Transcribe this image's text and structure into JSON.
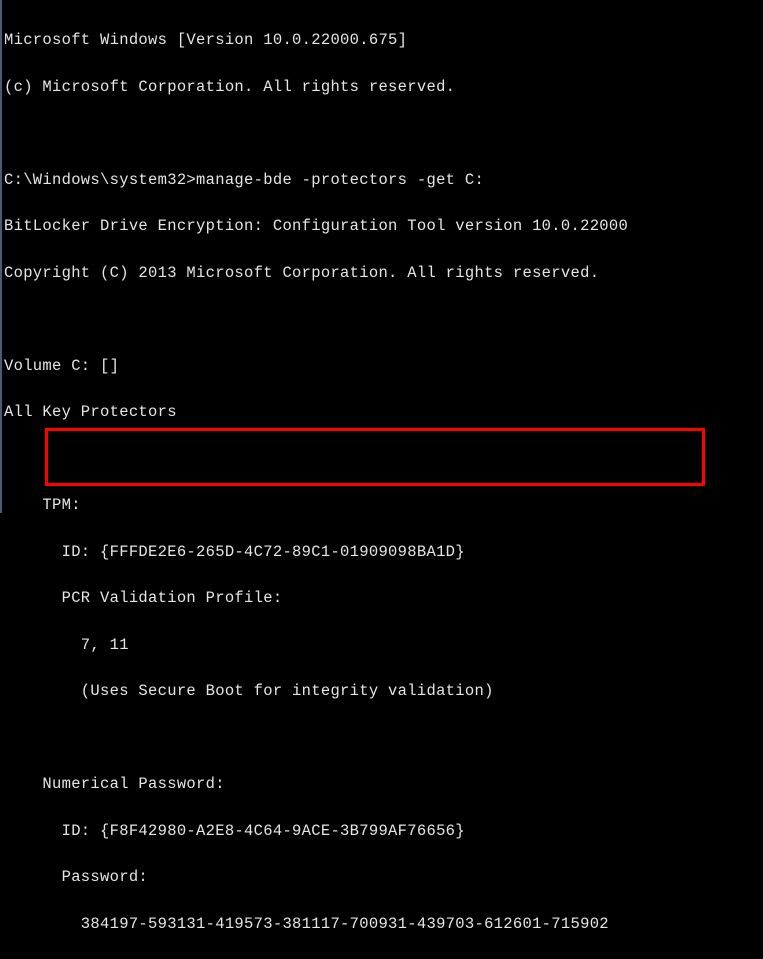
{
  "header": {
    "line1": "Microsoft Windows [Version 10.0.22000.675]",
    "line2": "(c) Microsoft Corporation. All rights reserved."
  },
  "command": {
    "prompt": "C:\\Windows\\system32>",
    "text": "manage-bde -protectors -get C:"
  },
  "tool": {
    "title": "BitLocker Drive Encryption: Configuration Tool version 10.0.22000",
    "copyright": "Copyright (C) 2013 Microsoft Corporation. All rights reserved."
  },
  "output": {
    "volume": "Volume C: []",
    "protectors_header": "All Key Protectors",
    "tpm": {
      "label": "    TPM:",
      "id": "      ID: {FFFDE2E6-265D-4C72-89C1-01909098BA1D}",
      "pcr": "      PCR Validation Profile:",
      "pcr_vals": "        7, 11",
      "note": "        (Uses Secure Boot for integrity validation)"
    },
    "numerical": {
      "label": "    Numerical Password:",
      "id": "      ID: {F8F42980-A2E8-4C64-9ACE-3B799AF76656}",
      "pw_label": "      Password:",
      "pw": "        384197-593131-419573-381117-700931-439703-612601-715902"
    }
  }
}
